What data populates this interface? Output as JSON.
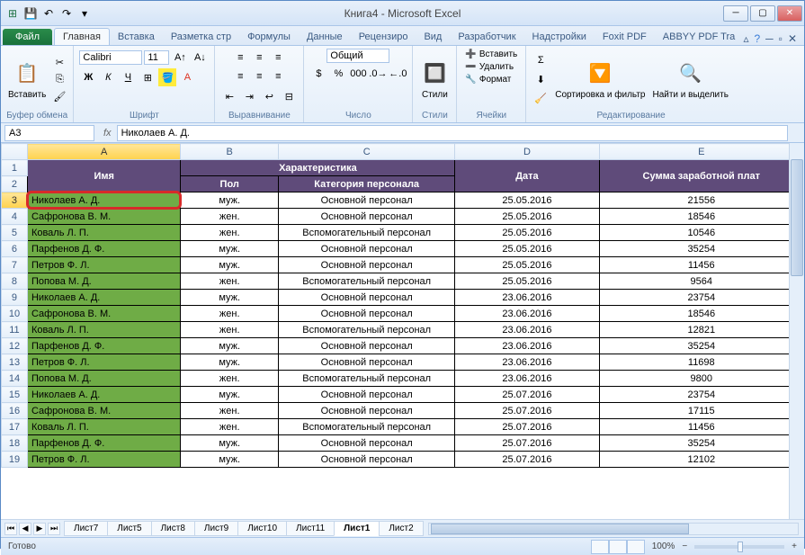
{
  "title": "Книга4 - Microsoft Excel",
  "qat": {
    "save": "💾",
    "undo": "↶",
    "redo": "↷"
  },
  "tabs": {
    "file": "Файл",
    "items": [
      "Главная",
      "Вставка",
      "Разметка стр",
      "Формулы",
      "Данные",
      "Рецензиро",
      "Вид",
      "Разработчик",
      "Надстройки",
      "Foxit PDF",
      "ABBYY PDF Tra"
    ]
  },
  "ribbon": {
    "clipboard": {
      "label": "Буфер обмена",
      "paste": "Вставить"
    },
    "font": {
      "label": "Шрифт",
      "name": "Calibri",
      "size": "11"
    },
    "align": {
      "label": "Выравнивание"
    },
    "number": {
      "label": "Число",
      "format": "Общий"
    },
    "styles": {
      "label": "Стили",
      "btn": "Стили"
    },
    "cells": {
      "label": "Ячейки",
      "insert": "Вставить",
      "delete": "Удалить",
      "format": "Формат"
    },
    "editing": {
      "label": "Редактирование",
      "sort": "Сортировка и фильтр",
      "find": "Найти и выделить"
    }
  },
  "namebox": "A3",
  "formula": "Николаев А. Д.",
  "cols": [
    "A",
    "B",
    "C",
    "D",
    "E"
  ],
  "header1": "Характеристика",
  "header2": {
    "name": "Имя",
    "gender": "Пол",
    "category": "Категория персонала",
    "date": "Дата",
    "salary": "Сумма заработной плат"
  },
  "rows": [
    {
      "n": 3,
      "name": "Николаев А. Д.",
      "g": "муж.",
      "c": "Основной персонал",
      "d": "25.05.2016",
      "s": "21556"
    },
    {
      "n": 4,
      "name": "Сафронова В. М.",
      "g": "жен.",
      "c": "Основной персонал",
      "d": "25.05.2016",
      "s": "18546"
    },
    {
      "n": 5,
      "name": "Коваль Л. П.",
      "g": "жен.",
      "c": "Вспомогательный персонал",
      "d": "25.05.2016",
      "s": "10546"
    },
    {
      "n": 6,
      "name": "Парфенов Д. Ф.",
      "g": "муж.",
      "c": "Основной персонал",
      "d": "25.05.2016",
      "s": "35254"
    },
    {
      "n": 7,
      "name": "Петров Ф. Л.",
      "g": "муж.",
      "c": "Основной персонал",
      "d": "25.05.2016",
      "s": "11456"
    },
    {
      "n": 8,
      "name": "Попова М. Д.",
      "g": "жен.",
      "c": "Вспомогательный персонал",
      "d": "25.05.2016",
      "s": "9564"
    },
    {
      "n": 9,
      "name": "Николаев А. Д.",
      "g": "муж.",
      "c": "Основной персонал",
      "d": "23.06.2016",
      "s": "23754"
    },
    {
      "n": 10,
      "name": "Сафронова В. М.",
      "g": "жен.",
      "c": "Основной персонал",
      "d": "23.06.2016",
      "s": "18546"
    },
    {
      "n": 11,
      "name": "Коваль Л. П.",
      "g": "жен.",
      "c": "Вспомогательный персонал",
      "d": "23.06.2016",
      "s": "12821"
    },
    {
      "n": 12,
      "name": "Парфенов Д. Ф.",
      "g": "муж.",
      "c": "Основной персонал",
      "d": "23.06.2016",
      "s": "35254"
    },
    {
      "n": 13,
      "name": "Петров Ф. Л.",
      "g": "муж.",
      "c": "Основной персонал",
      "d": "23.06.2016",
      "s": "11698"
    },
    {
      "n": 14,
      "name": "Попова М. Д.",
      "g": "жен.",
      "c": "Вспомогательный персонал",
      "d": "23.06.2016",
      "s": "9800"
    },
    {
      "n": 15,
      "name": "Николаев А. Д.",
      "g": "муж.",
      "c": "Основной персонал",
      "d": "25.07.2016",
      "s": "23754"
    },
    {
      "n": 16,
      "name": "Сафронова В. М.",
      "g": "жен.",
      "c": "Основной персонал",
      "d": "25.07.2016",
      "s": "17115"
    },
    {
      "n": 17,
      "name": "Коваль Л. П.",
      "g": "жен.",
      "c": "Вспомогательный персонал",
      "d": "25.07.2016",
      "s": "11456"
    },
    {
      "n": 18,
      "name": "Парфенов Д. Ф.",
      "g": "муж.",
      "c": "Основной персонал",
      "d": "25.07.2016",
      "s": "35254"
    },
    {
      "n": 19,
      "name": "Петров Ф. Л.",
      "g": "муж.",
      "c": "Основной персонал",
      "d": "25.07.2016",
      "s": "12102"
    }
  ],
  "sheets": [
    "Лист7",
    "Лист5",
    "Лист8",
    "Лист9",
    "Лист10",
    "Лист11",
    "Лист1",
    "Лист2"
  ],
  "active_sheet": 6,
  "status": {
    "ready": "Готово",
    "zoom": "100%"
  }
}
